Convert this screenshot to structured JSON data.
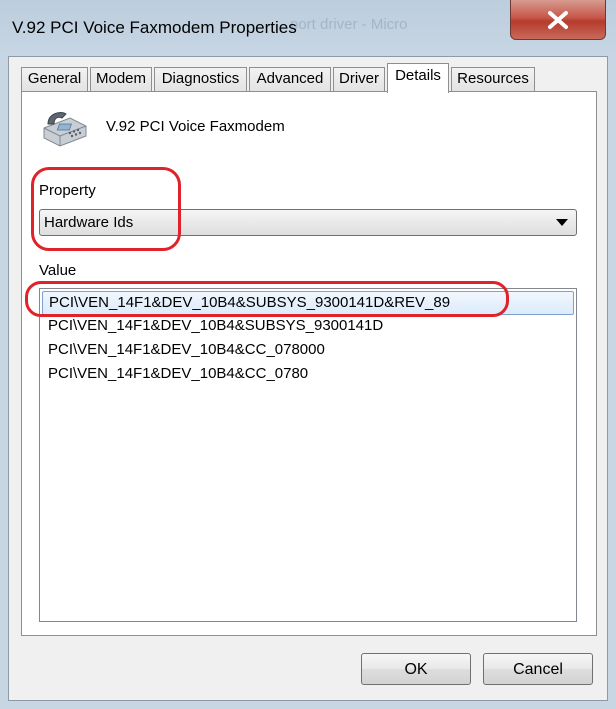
{
  "window": {
    "title": "V.92 PCI Voice Faxmodem Properties",
    "background_ghost_text": "port driver - Micro"
  },
  "tabs": [
    {
      "label": "General"
    },
    {
      "label": "Modem"
    },
    {
      "label": "Diagnostics"
    },
    {
      "label": "Advanced"
    },
    {
      "label": "Driver"
    },
    {
      "label": "Details",
      "active": true
    },
    {
      "label": "Resources"
    }
  ],
  "device": {
    "icon": "fax-machine-icon",
    "name": "V.92 PCI Voice Faxmodem"
  },
  "property": {
    "label": "Property",
    "selected": "Hardware Ids"
  },
  "value": {
    "label": "Value",
    "items": [
      "PCI\\VEN_14F1&DEV_10B4&SUBSYS_9300141D&REV_89",
      "PCI\\VEN_14F1&DEV_10B4&SUBSYS_9300141D",
      "PCI\\VEN_14F1&DEV_10B4&CC_078000",
      "PCI\\VEN_14F1&DEV_10B4&CC_0780"
    ],
    "selected_index": 0
  },
  "buttons": {
    "ok": "OK",
    "cancel": "Cancel"
  },
  "colors": {
    "annotation": "#e0222a",
    "selection_border": "#7da2ce",
    "close_button": "#c7574a"
  }
}
